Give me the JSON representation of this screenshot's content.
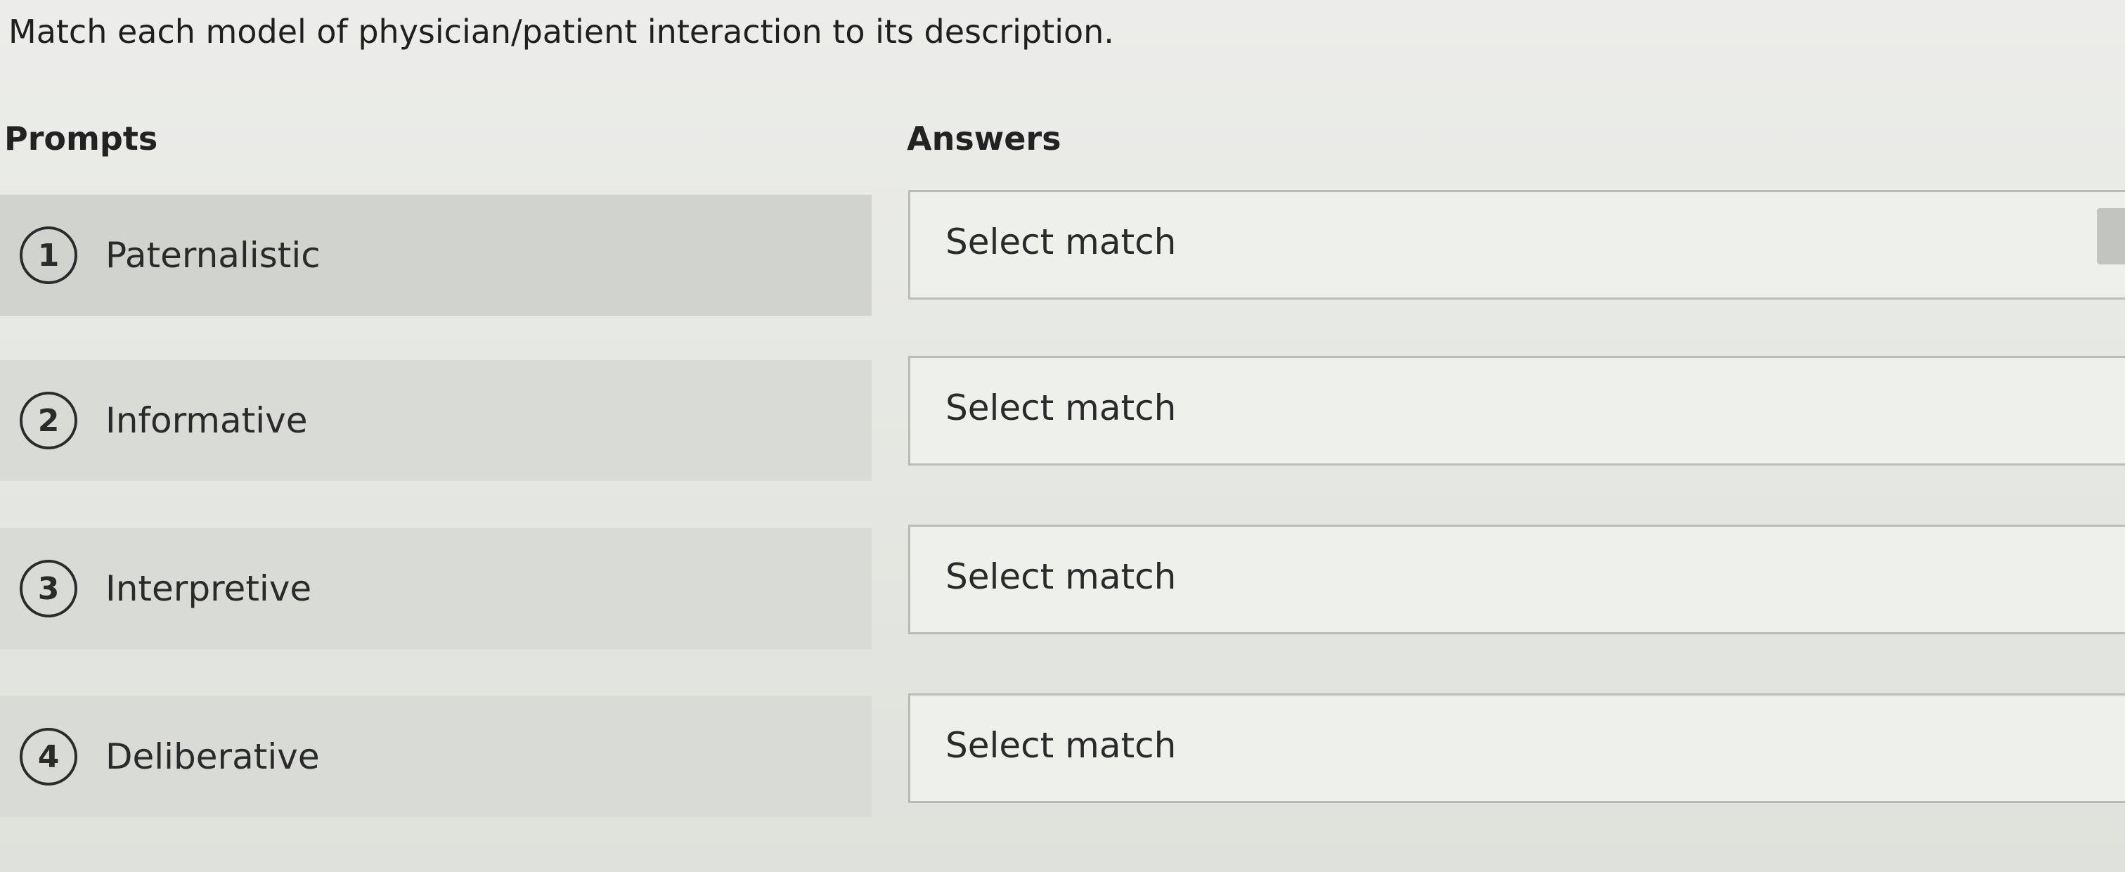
{
  "instruction": "Match each model of physician/patient interaction to its description.",
  "headers": {
    "prompts": "Prompts",
    "answers": "Answers"
  },
  "prompts": [
    {
      "number": "1",
      "label": "Paternalistic"
    },
    {
      "number": "2",
      "label": "Informative"
    },
    {
      "number": "3",
      "label": "Interpretive"
    },
    {
      "number": "4",
      "label": "Deliberative"
    }
  ],
  "answers": [
    {
      "value": "Select match"
    },
    {
      "value": "Select match"
    },
    {
      "value": "Select match"
    },
    {
      "value": "Select match"
    }
  ]
}
